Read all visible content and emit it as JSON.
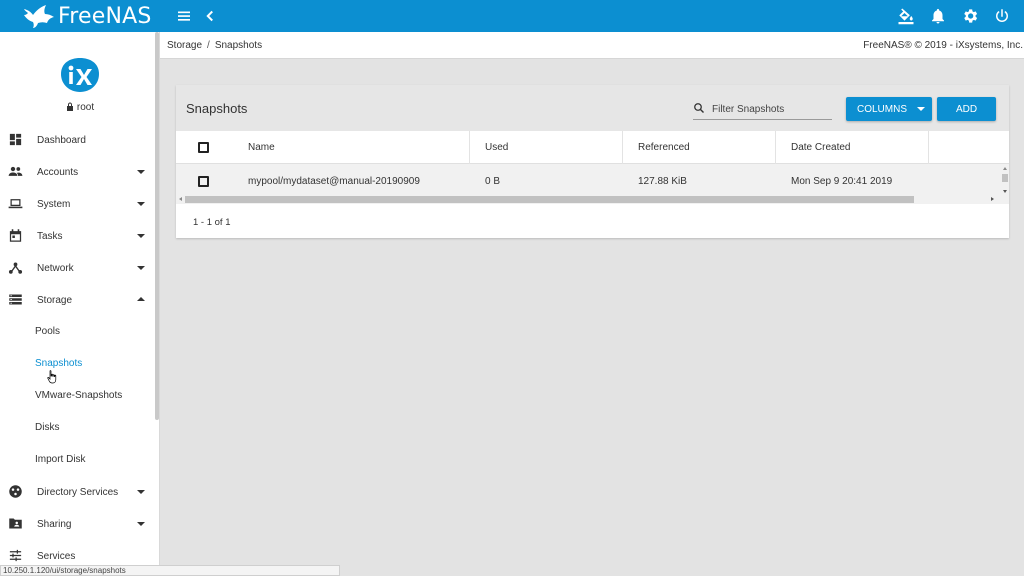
{
  "app": {
    "name": "FreeNAS"
  },
  "topbar": {
    "icons": [
      "menu-icon",
      "chevron-left-icon",
      "paint-bucket-icon",
      "bell-icon",
      "gear-icon",
      "power-icon"
    ]
  },
  "sidebar": {
    "user": "root",
    "items": [
      {
        "label": "Dashboard",
        "icon": "dashboard-icon"
      },
      {
        "label": "Accounts",
        "icon": "people-icon"
      },
      {
        "label": "System",
        "icon": "laptop-icon"
      },
      {
        "label": "Tasks",
        "icon": "calendar-icon"
      },
      {
        "label": "Network",
        "icon": "network-icon"
      },
      {
        "label": "Storage",
        "icon": "storage-icon"
      },
      {
        "label": "Directory Services",
        "icon": "directory-icon"
      },
      {
        "label": "Sharing",
        "icon": "folder-shared-icon"
      },
      {
        "label": "Services",
        "icon": "sliders-icon"
      }
    ],
    "storage_sub": [
      "Pools",
      "Snapshots",
      "VMware-Snapshots",
      "Disks",
      "Import Disk"
    ]
  },
  "breadcrumb": {
    "parent": "Storage",
    "sep": "/",
    "current": "Snapshots"
  },
  "copyright": "FreeNAS® © 2019 - iXsystems, Inc.",
  "card": {
    "title": "Snapshots",
    "filter_placeholder": "Filter Snapshots",
    "columns_label": "COLUMNS",
    "add_label": "ADD",
    "headers": [
      "Name",
      "Used",
      "Referenced",
      "Date Created"
    ],
    "rows": [
      {
        "name": "mypool/mydataset@manual-20190909",
        "used": "0 B",
        "referenced": "127.88 KiB",
        "date": "Mon Sep 9 20:41 2019"
      }
    ],
    "pager": "1 - 1 of 1"
  },
  "status_url": "10.250.1.120/ui/storage/snapshots",
  "colors": {
    "accent": "#0c8fd1",
    "background": "#e3e3e3"
  }
}
